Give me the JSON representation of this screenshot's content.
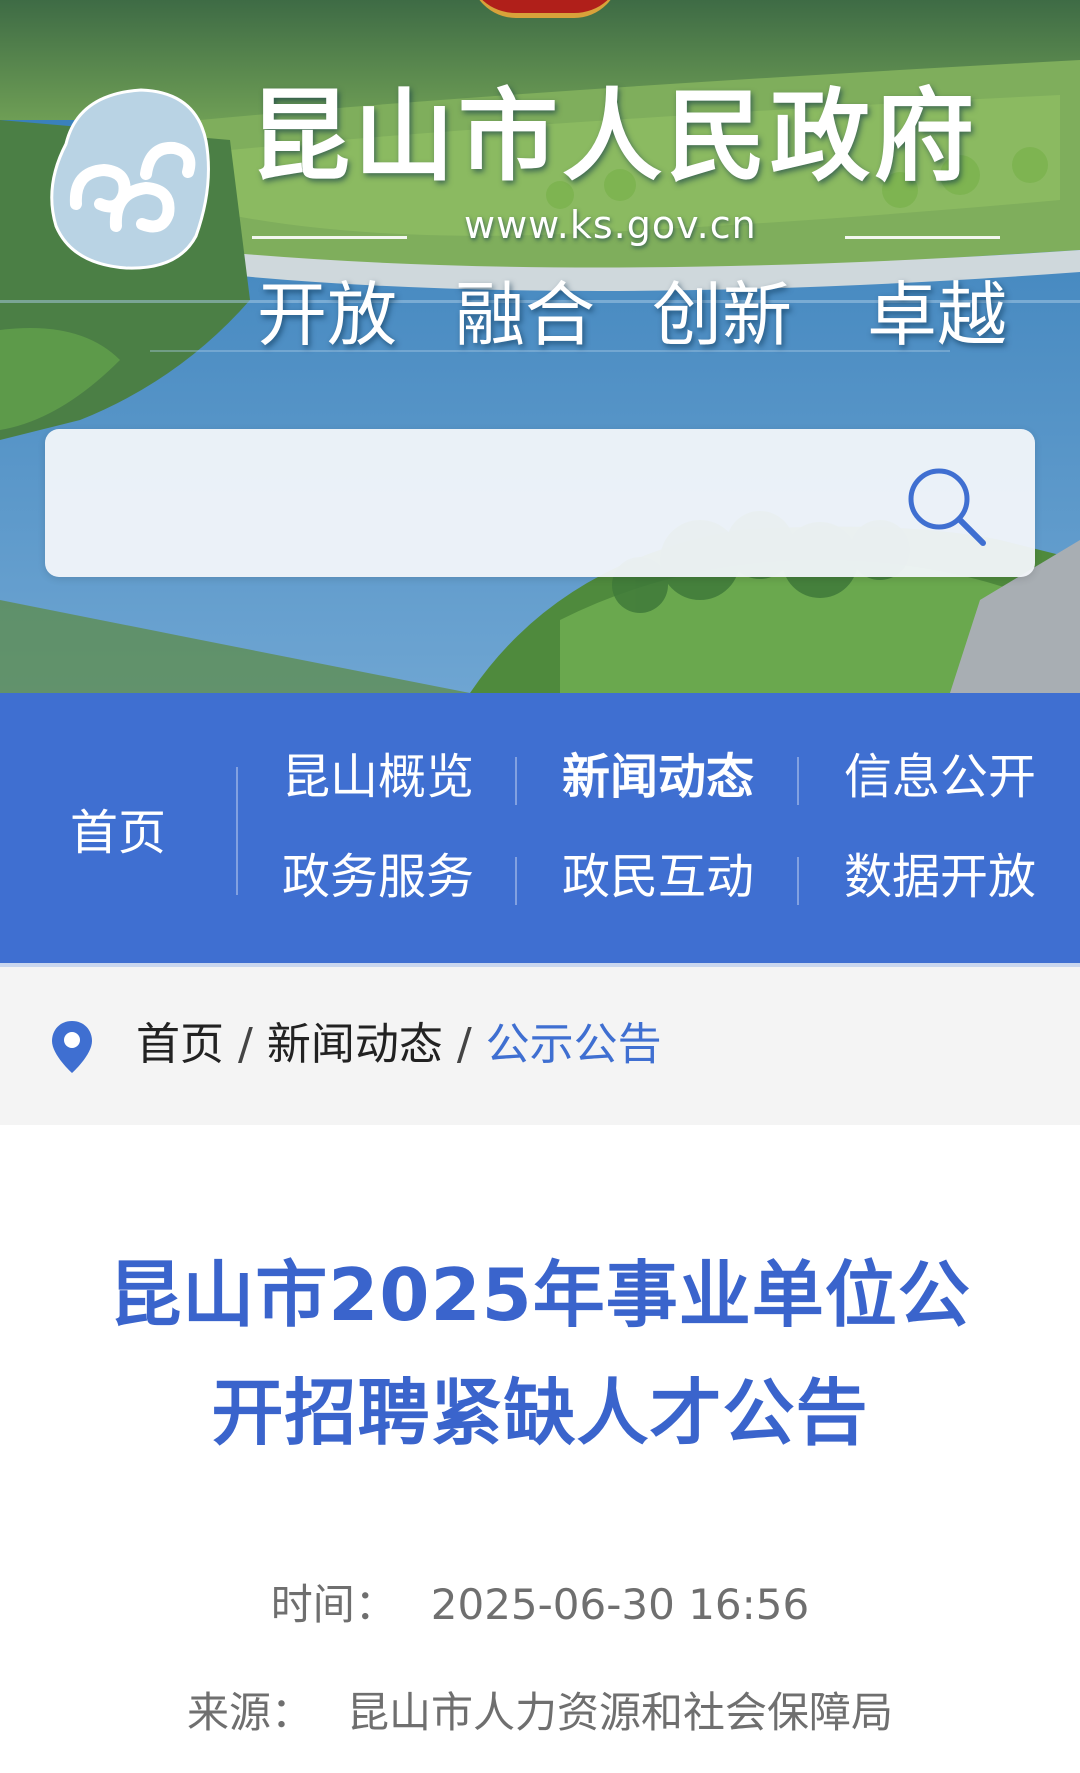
{
  "banner": {
    "title": "昆山市人民政府",
    "url": "www.ks.gov.cn",
    "slogan": [
      "开放",
      "融合",
      "创新",
      "卓越"
    ]
  },
  "search": {
    "placeholder": "",
    "value": ""
  },
  "nav": {
    "home": "首页",
    "items": [
      {
        "label": "昆山概览"
      },
      {
        "label": "新闻动态",
        "active": true
      },
      {
        "label": "信息公开"
      },
      {
        "label": "政务服务"
      },
      {
        "label": "政民互动"
      },
      {
        "label": "数据开放"
      }
    ]
  },
  "breadcrumb": {
    "items": [
      "首页",
      "新闻动态",
      "公示公告"
    ],
    "separator": "/"
  },
  "article": {
    "title_line1": "昆山市2025年事业单位公",
    "title_line2": "开招聘紧缺人才公告",
    "time_label": "时间：",
    "time_value": "2025-06-30 16:56",
    "source_label": "来源：",
    "source_value": "昆山市人力资源和社会保障局"
  },
  "colors": {
    "nav_background": "#3f6fd1",
    "title_blue": "#3a64cc",
    "breadcrumb_current": "#3f6fd1",
    "meta_gray": "#6f6f6f"
  },
  "icons": {
    "logo": "kunshan-cloud-logo-icon",
    "search": "search-icon",
    "location": "location-pin-icon"
  }
}
